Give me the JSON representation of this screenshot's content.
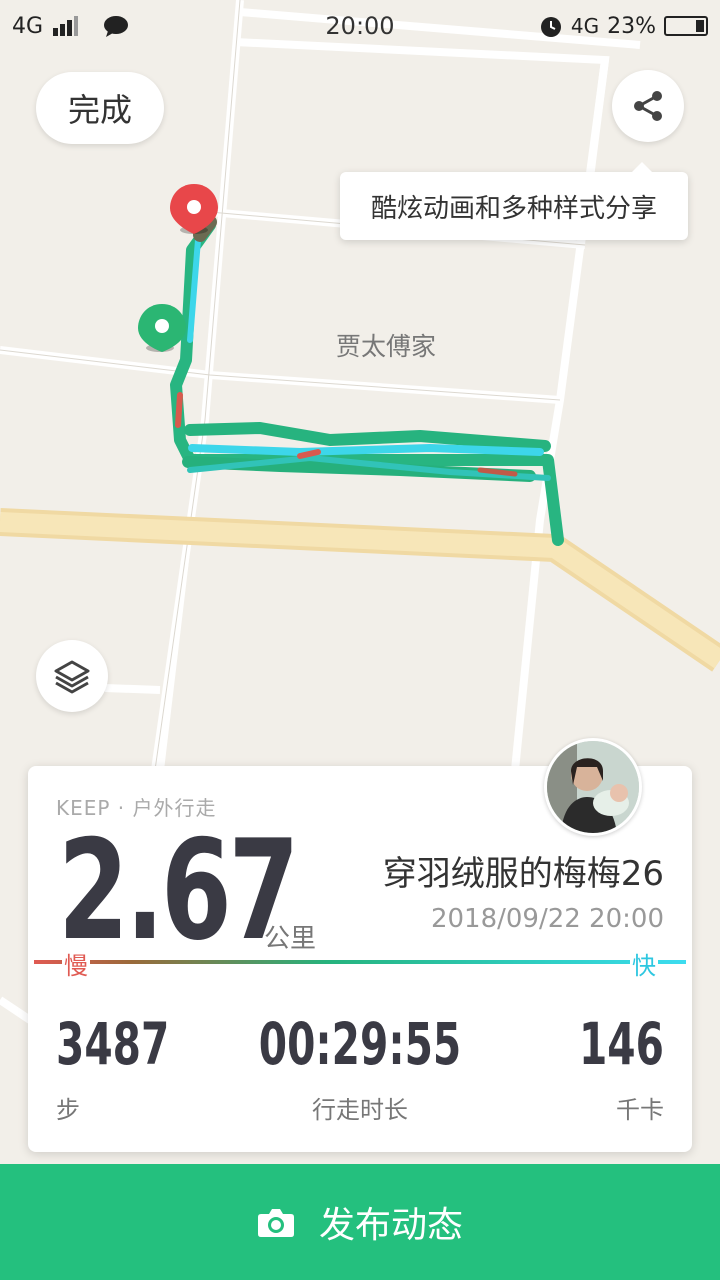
{
  "status_bar": {
    "network": "4G",
    "time": "20:00",
    "network2": "4G",
    "battery": "23%"
  },
  "map": {
    "poi_label": "贾太傅家"
  },
  "buttons": {
    "done_label": "完成",
    "share_icon": "share-icon",
    "layers_icon": "layers-icon"
  },
  "tooltip": {
    "text": "酷炫动画和多种样式分享"
  },
  "summary_card": {
    "source": "KEEP · 户外行走",
    "distance": "2.67",
    "distance_unit": "公里",
    "username": "穿羽绒服的梅梅26",
    "datetime": "2018/09/22 20:00",
    "speed_slow_label": "慢",
    "speed_fast_label": "快",
    "stats": [
      {
        "value": "3487",
        "label": "步"
      },
      {
        "value": "00:29:55",
        "label": "行走时长"
      },
      {
        "value": "146",
        "label": "千卡"
      }
    ]
  },
  "post_bar": {
    "label": "发布动态",
    "icon": "camera-icon"
  },
  "colors": {
    "brand_green": "#24c07e",
    "slow_red": "#e05a52",
    "fast_cyan": "#2ec7e0",
    "start_pin": "#2bb673",
    "end_pin": "#e8474a"
  }
}
